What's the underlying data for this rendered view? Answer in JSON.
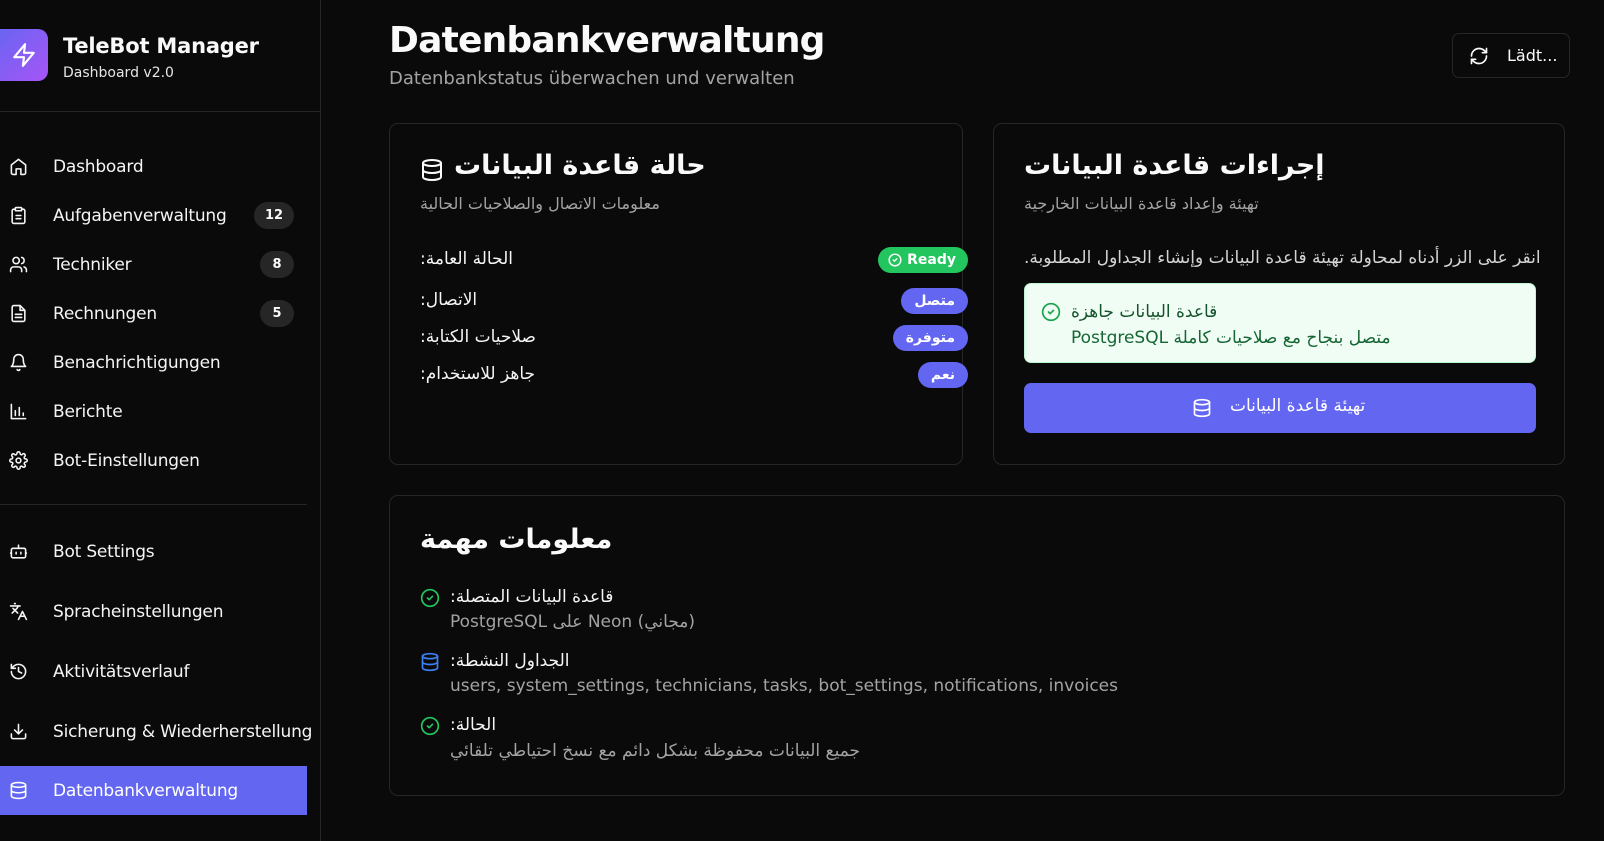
{
  "brand": {
    "title": "TeleBot Manager",
    "subtitle": "Dashboard v2.0",
    "logo_icon": "zap-icon"
  },
  "nav": [
    {
      "label": "Dashboard",
      "icon": "home-icon"
    },
    {
      "label": "Aufgabenverwaltung",
      "icon": "clipboard-icon",
      "badge": "12"
    },
    {
      "label": "Techniker",
      "icon": "users-icon",
      "badge": "8"
    },
    {
      "label": "Rechnungen",
      "icon": "file-text-icon",
      "badge": "5"
    },
    {
      "label": "Benachrichtigungen",
      "icon": "bell-icon"
    },
    {
      "label": "Berichte",
      "icon": "bar-chart-icon"
    },
    {
      "label": "Bot-Einstellungen",
      "icon": "gear-icon"
    },
    {
      "label": "Bot Settings",
      "icon": "bot-icon"
    },
    {
      "label": "Spracheinstellungen",
      "icon": "languages-icon"
    },
    {
      "label": "Aktivitätsverlauf",
      "icon": "history-icon"
    },
    {
      "label": "Sicherung & Wiederherstellung",
      "icon": "download-icon"
    },
    {
      "label": "Datenbankverwaltung",
      "icon": "database-icon",
      "active": true
    }
  ],
  "header": {
    "title": "Datenbankverwaltung",
    "subtitle": "Datenbankstatus überwachen und verwalten",
    "refresh_label": "Lädt..."
  },
  "status_card": {
    "title": "حالة قاعدة البيانات",
    "description": "معلومات الاتصال والصلاحيات الحالية",
    "rows": [
      {
        "label": "الحالة العامة:",
        "badge": "Ready"
      },
      {
        "label": "الاتصال:",
        "badge": "متصل"
      },
      {
        "label": "صلاحيات الكتابة:",
        "badge": "متوفرة"
      },
      {
        "label": "جاهز للاستخدام:",
        "badge": "نعم"
      }
    ]
  },
  "actions_card": {
    "title": "إجراءات قاعدة البيانات",
    "description": "تهيئة وإعداد قاعدة البيانات الخارجية",
    "instruction": "انقر على الزر أدناه لمحاولة تهيئة قاعدة البيانات وإنشاء الجداول المطلوبة.",
    "alert_title": "قاعدة البيانات جاهزة",
    "alert_text": "متصل بنجاح مع صلاحيات كاملة PostgreSQL",
    "button_label": "تهيئة قاعدة البيانات"
  },
  "info_card": {
    "title": "معلومات مهمة",
    "items": [
      {
        "title": "قاعدة البيانات المتصلة:",
        "text": "PostgreSQL على Neon (مجاني)",
        "icon": "check-circle-icon"
      },
      {
        "title": "الجداول النشطة:",
        "text": "users, system_settings, technicians, tasks, bot_settings, notifications, invoices",
        "icon": "database-icon"
      },
      {
        "title": "الحالة:",
        "text": "جميع البيانات محفوظة بشكل دائم مع نسخ احتياطي تلقائي",
        "icon": "check-circle-icon"
      }
    ]
  },
  "colors": {
    "background": "#0a0a0a",
    "accent": "#6366f1",
    "success": "#22c55e",
    "border": "#262626",
    "muted_text": "#a3a3a3",
    "info_blue": "#3b82f6"
  }
}
